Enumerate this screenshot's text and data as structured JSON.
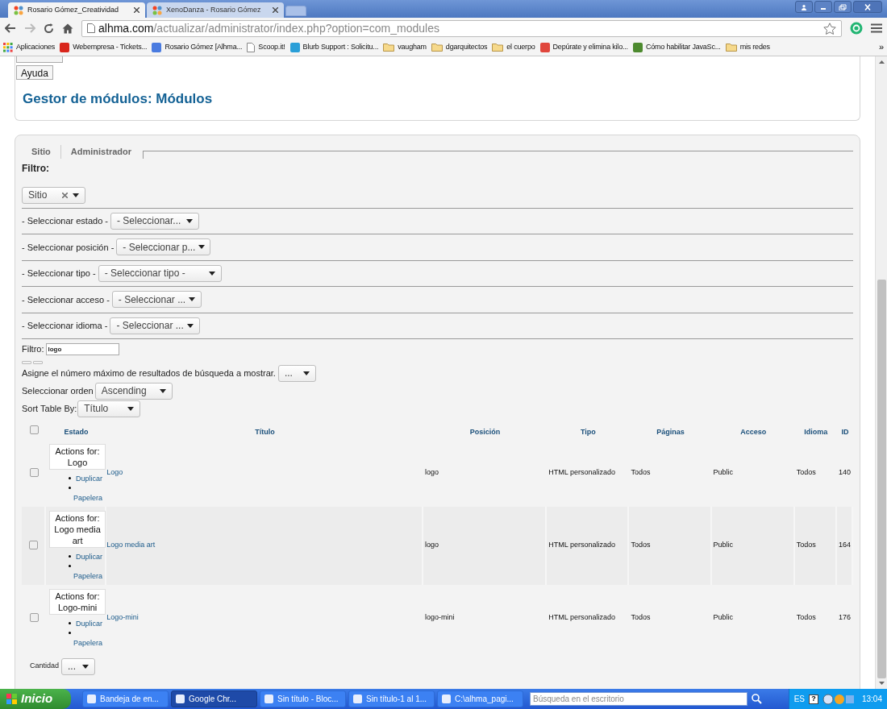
{
  "browser": {
    "tabs": [
      {
        "title": "Rosario Gómez_Creatividad",
        "selected": true
      },
      {
        "title": "XenoDanza - Rosario Gómez",
        "selected": false
      }
    ],
    "url_host": "alhma.com",
    "url_path": "/actualizar/administrator/index.php?option=com_modules",
    "bookmarks": [
      {
        "label": "Aplicaciones",
        "kind": "apps"
      },
      {
        "label": "Webempresa - Tickets...",
        "kind": "site",
        "color": "#d9261c"
      },
      {
        "label": "Rosario Gómez [Alhma...",
        "kind": "site",
        "color": "#4a7be0"
      },
      {
        "label": "Scoop.it!",
        "kind": "page"
      },
      {
        "label": "Blurb Support : Solicitu...",
        "kind": "site",
        "color": "#2a9fd8"
      },
      {
        "label": "vaugham",
        "kind": "folder"
      },
      {
        "label": "dgarquitectos",
        "kind": "folder"
      },
      {
        "label": "el cuerpo",
        "kind": "folder"
      },
      {
        "label": "Depúrate y elimina kilo...",
        "kind": "site",
        "color": "#e0463c"
      },
      {
        "label": "Cómo habilitar JavaSc...",
        "kind": "site",
        "color": "#4d8a2f"
      },
      {
        "label": "mis redes",
        "kind": "folder"
      }
    ],
    "bookmarks_more": "»"
  },
  "toolbar": {
    "help_button": "Ayuda"
  },
  "page_title": "Gestor de módulos: Módulos",
  "client_tabs": [
    "Sitio",
    "Administrador"
  ],
  "filter_heading": "Filtro:",
  "client_select": {
    "value": "Sitio"
  },
  "filters": [
    {
      "label": "- Seleccionar estado -",
      "value": "- Seleccionar..."
    },
    {
      "label": "- Seleccionar posición -",
      "value": "- Seleccionar p..."
    },
    {
      "label": "- Seleccionar tipo -",
      "value": "- Seleccionar tipo -"
    },
    {
      "label": "- Seleccionar acceso -",
      "value": "- Seleccionar ..."
    },
    {
      "label": "- Seleccionar idioma -",
      "value": "- Seleccionar ..."
    }
  ],
  "search": {
    "label": "Filtro:",
    "value": "logo"
  },
  "limit": {
    "label": "Asigne el número máximo de resultados de búsqueda a mostrar.",
    "value": "..."
  },
  "order": {
    "label": "Seleccionar orden",
    "value": "Ascending"
  },
  "sort": {
    "label": "Sort Table By:",
    "value": "Título"
  },
  "table": {
    "select_all_checked": false,
    "columns": [
      "Estado",
      "Título",
      "Posición",
      "Tipo",
      "Páginas",
      "Acceso",
      "Idioma",
      "ID"
    ],
    "rows": [
      {
        "checked": false,
        "highlighted": false,
        "actions_title": "Actions for: Logo",
        "actions": [
          "Duplicar",
          "Papelera"
        ],
        "title": "Logo",
        "position": "logo",
        "type": "HTML personalizado",
        "pages": "Todos",
        "access": "Public",
        "language": "Todos",
        "id": "140"
      },
      {
        "checked": false,
        "highlighted": true,
        "actions_title": "Actions for: Logo media art",
        "actions": [
          "Duplicar",
          "Papelera"
        ],
        "title": "Logo media art",
        "position": "logo",
        "type": "HTML personalizado",
        "pages": "Todos",
        "access": "Public",
        "language": "Todos",
        "id": "164"
      },
      {
        "checked": false,
        "highlighted": false,
        "actions_title": "Actions for: Logo-mini",
        "actions": [
          "Duplicar",
          "Papelera"
        ],
        "title": "Logo-mini",
        "position": "logo-mini",
        "type": "HTML personalizado",
        "pages": "Todos",
        "access": "Public",
        "language": "Todos",
        "id": "176"
      }
    ]
  },
  "quantity": {
    "label": "Cantidad",
    "value": "..."
  },
  "taskbar": {
    "start": "Inicio",
    "tasks": [
      {
        "label": "Bandeja de en...",
        "selected": false
      },
      {
        "label": "Google Chr...",
        "selected": true
      },
      {
        "label": "Sin título - Bloc...",
        "selected": false
      },
      {
        "label": "Sin título-1 al 1...",
        "selected": false
      },
      {
        "label": "C:\\alhma_pagi...",
        "selected": false
      }
    ],
    "search_placeholder": "Búsqueda en el escritorio",
    "language": "ES",
    "help": "?",
    "clock": "13:04"
  }
}
